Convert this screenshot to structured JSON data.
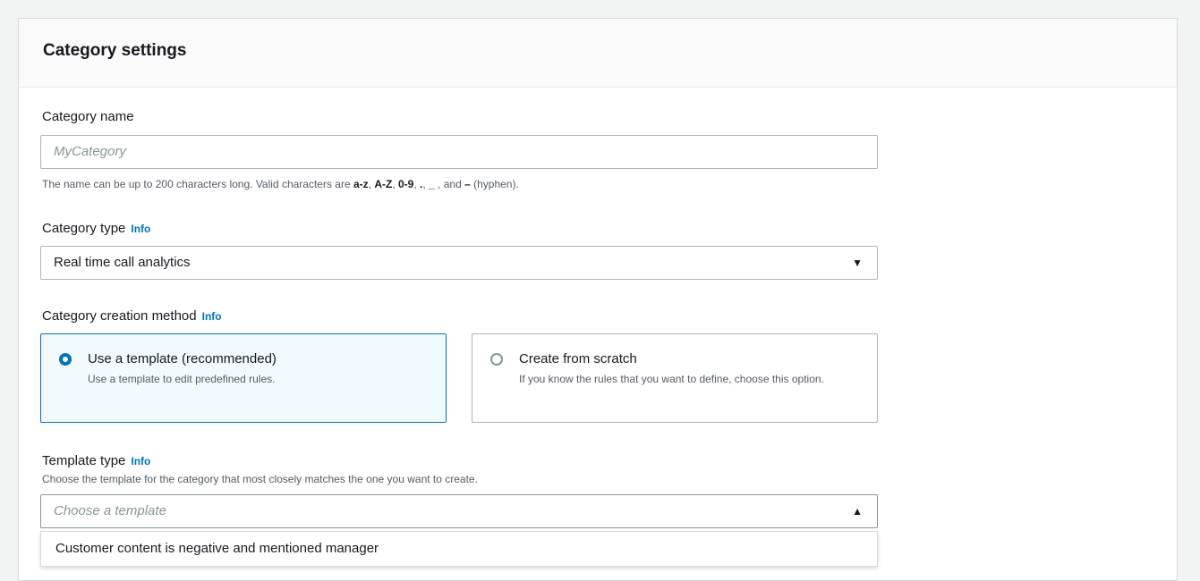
{
  "panel": {
    "title": "Category settings"
  },
  "category_name": {
    "label": "Category name",
    "placeholder": "MyCategory",
    "hint_prefix": "The name can be up to 200 characters long. Valid characters are ",
    "hint_az": "a-z",
    "hint_sep1": ", ",
    "hint_AZ": "A-Z",
    "hint_sep2": ", ",
    "hint_09": "0-9",
    "hint_sep3": ", ",
    "hint_dot": ".",
    "hint_sep4": ", ",
    "hint_underscore": "_",
    "hint_sep5": " , and ",
    "hint_dash": "–",
    "hint_suffix": " (hyphen)."
  },
  "category_type": {
    "label": "Category type",
    "info": "Info",
    "value": "Real time call analytics"
  },
  "creation_method": {
    "label": "Category creation method",
    "info": "Info",
    "options": [
      {
        "title": "Use a template (recommended)",
        "description": "Use a template to edit predefined rules.",
        "selected": true
      },
      {
        "title": "Create from scratch",
        "description": "If you know the rules that you want to define, choose this option.",
        "selected": false
      }
    ]
  },
  "template_type": {
    "label": "Template type",
    "info": "Info",
    "description": "Choose the template for the category that most closely matches the one you want to create.",
    "placeholder": "Choose a template",
    "options": [
      "Customer content is negative and mentioned manager"
    ]
  },
  "colors": {
    "accent": "#0073bb",
    "selected_bg": "#f1faff",
    "border": "#aab7b8"
  }
}
